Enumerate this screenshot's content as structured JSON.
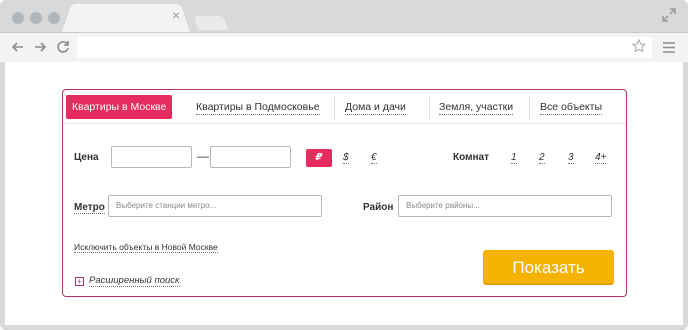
{
  "browser": {
    "tab_close": "×"
  },
  "search": {
    "tabs": [
      {
        "label": "Квартиры в Москве"
      },
      {
        "label": "Квартиры в Подмосковье"
      },
      {
        "label": "Дома и дачи"
      },
      {
        "label": "Земля, участки"
      },
      {
        "label": "Все объекты"
      }
    ],
    "price_label": "Цена",
    "price_dash": "—",
    "currencies": [
      "₽",
      "$",
      "€"
    ],
    "rooms_label": "Комнат",
    "rooms": [
      "1",
      "2",
      "3",
      "4+"
    ],
    "metro_label": "Метро",
    "metro_placeholder": "Выберите станции метро...",
    "district_label": "Район",
    "district_placeholder": "Выберите районы...",
    "exclude_link": "Исключить объекты в Новой Москве",
    "advanced_icon": "+",
    "advanced_link": "Расширенный поиск",
    "submit_label": "Показать"
  },
  "colors": {
    "accent": "#e62c5e",
    "border": "#b3306f",
    "button": "#f5b200",
    "chrome": "#d7d9da"
  }
}
